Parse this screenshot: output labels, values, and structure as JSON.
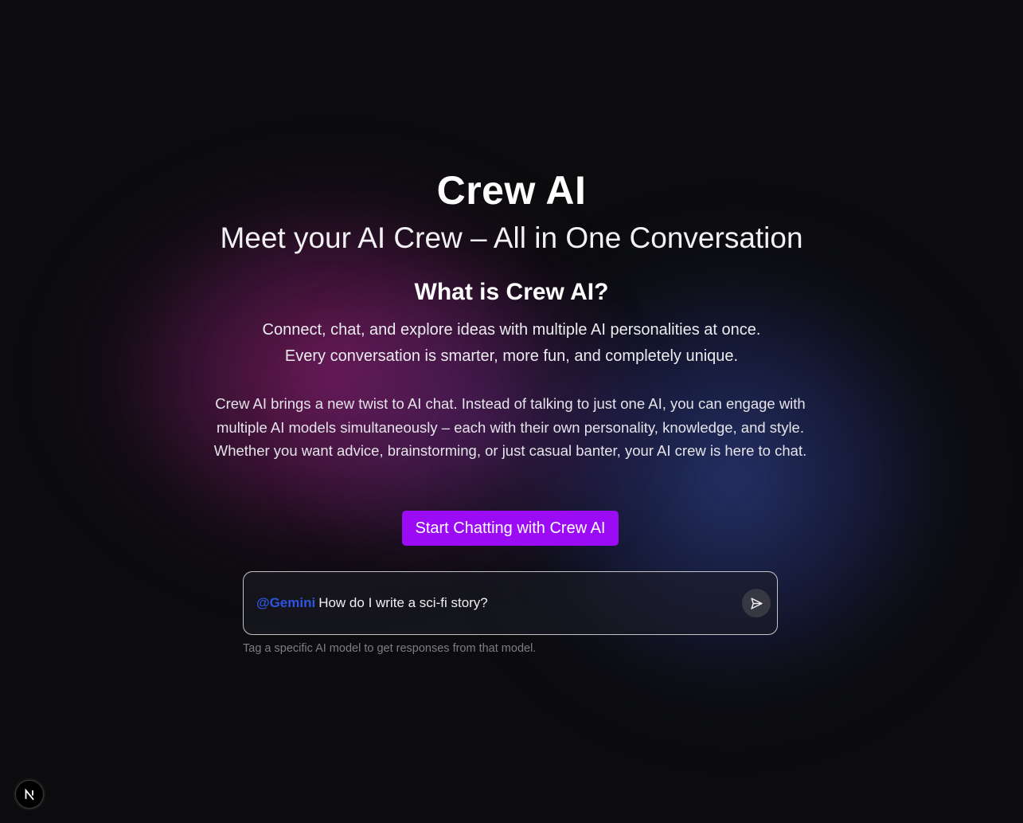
{
  "hero": {
    "title": "Crew AI",
    "subtitle": "Meet your AI Crew – All in One Conversation"
  },
  "about": {
    "heading": "What is Crew AI?",
    "tagline_line1": "Connect, chat, and explore ideas with multiple AI personalities at once.",
    "tagline_line2": "Every conversation is smarter, more fun, and completely unique.",
    "description": "Crew AI brings a new twist to AI chat. Instead of talking to just one AI, you can engage with multiple AI models simultaneously – each with their own personality, knowledge, and style. Whether you want advice, brainstorming, or just casual banter, your AI crew is here to chat."
  },
  "cta": {
    "label": "Start Chatting with Crew AI"
  },
  "chat": {
    "mention": "@Gemini",
    "message": "How do I write a sci-fi story?",
    "send_icon": "send-icon",
    "hint": "Tag a specific AI model to get responses from that model."
  },
  "badge": {
    "icon": "nextjs-logo-icon",
    "letter": "N"
  },
  "colors": {
    "background": "#0c0c0e",
    "cta_background": "#9b0cf5",
    "mention": "#2d55e0",
    "hint_text": "#7d7d86"
  }
}
